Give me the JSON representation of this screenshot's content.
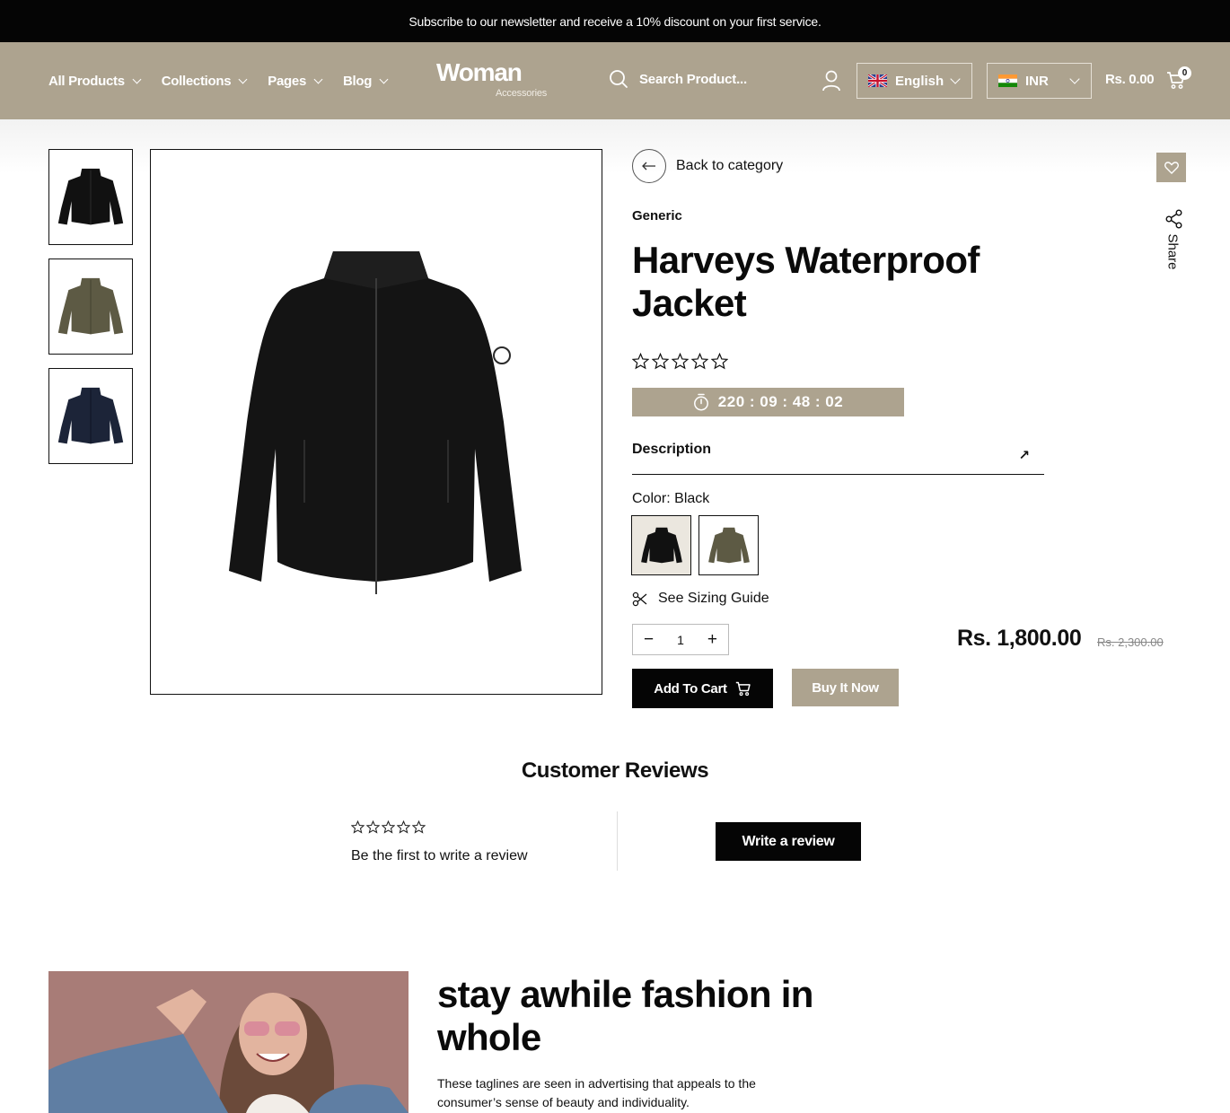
{
  "announcement": "Subscribe to our newsletter and receive a 10% discount on your first service.",
  "nav": {
    "items": [
      {
        "label": "All Products"
      },
      {
        "label": "Collections"
      },
      {
        "label": "Pages"
      },
      {
        "label": "Blog"
      }
    ]
  },
  "logo": {
    "main": "Woman",
    "sub": "Accessories"
  },
  "search": {
    "placeholder": "Search Product..."
  },
  "language": {
    "selected": "English"
  },
  "currency": {
    "selected": "INR"
  },
  "cart": {
    "total": "Rs. 0.00",
    "count": "0"
  },
  "product": {
    "back_label": "Back to category",
    "share_label": "Share",
    "vendor": "Generic",
    "title": "Harveys Waterproof Jacket",
    "rating": 0,
    "countdown": "220 : 09 : 48 : 02",
    "description_label": "Description",
    "color_label": "Color:",
    "color_value": "Black",
    "swatches": [
      "Black",
      "Olive"
    ],
    "sizing_label": "See Sizing Guide",
    "quantity": "1",
    "price": "Rs. 1,800.00",
    "compare_price": "Rs. 2,300.00",
    "add_to_cart": "Add To Cart",
    "buy_now": "Buy It Now",
    "thumbnails": [
      "black",
      "olive",
      "navy"
    ]
  },
  "reviews": {
    "title": "Customer Reviews",
    "empty_text": "Be the first to write a review",
    "write_button": "Write a review"
  },
  "promo": {
    "heading": "stay awhile fashion in whole",
    "text": "These taglines are seen in advertising that appeals to the consumer’s sense of beauty and individuality."
  },
  "colors": {
    "brand_tan": "#ada38f",
    "black": "#050505",
    "jacket_black": "#111111",
    "jacket_olive": "#5d5a44",
    "jacket_navy": "#1c2438"
  }
}
